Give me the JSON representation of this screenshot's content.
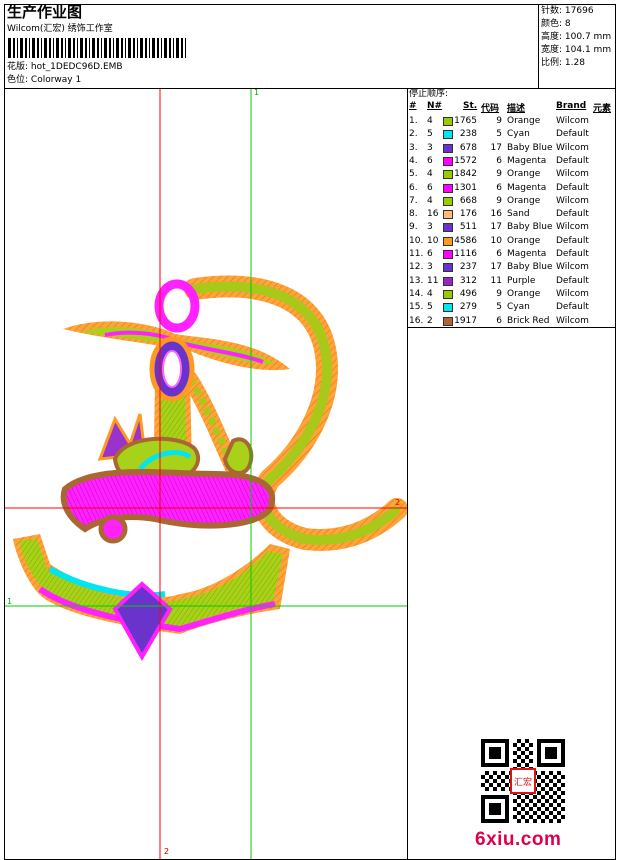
{
  "header": {
    "title": "生产作业图",
    "company": "Wilcom(汇宏) 绣饰工作室",
    "design_label": "花版:",
    "design_value": "hot_1DEDC96D.EMB",
    "colorway_label": "色位:",
    "colorway_value": "Colorway 1"
  },
  "stats": [
    {
      "label": "针数:",
      "value": "17696"
    },
    {
      "label": "颜色:",
      "value": "8"
    },
    {
      "label": "高度:",
      "value": "100.7 mm"
    },
    {
      "label": "宽度:",
      "value": "104.1 mm"
    },
    {
      "label": "比例:",
      "value": "1.28"
    }
  ],
  "sequence": {
    "title": "停止顺序:",
    "headers": {
      "num": "#",
      "needle": "N#",
      "st": "St.",
      "code": "代码",
      "desc": "描述",
      "brand": "Brand",
      "elem": "元素"
    },
    "rows": [
      {
        "num": "1.",
        "needle": "4",
        "color": "#99cc00",
        "st": "1765",
        "code": "9",
        "desc": "Orange",
        "brand": "Wilcom"
      },
      {
        "num": "2.",
        "needle": "5",
        "color": "#00e5ee",
        "st": "238",
        "code": "5",
        "desc": "Cyan",
        "brand": "Default"
      },
      {
        "num": "3.",
        "needle": "3",
        "color": "#6633cc",
        "st": "678",
        "code": "17",
        "desc": "Baby Blue",
        "brand": "Wilcom"
      },
      {
        "num": "4.",
        "needle": "6",
        "color": "#ff00ff",
        "st": "1572",
        "code": "6",
        "desc": "Magenta",
        "brand": "Default"
      },
      {
        "num": "5.",
        "needle": "4",
        "color": "#99cc00",
        "st": "1842",
        "code": "9",
        "desc": "Orange",
        "brand": "Wilcom"
      },
      {
        "num": "6.",
        "needle": "6",
        "color": "#ff00ff",
        "st": "1301",
        "code": "6",
        "desc": "Magenta",
        "brand": "Default"
      },
      {
        "num": "7.",
        "needle": "4",
        "color": "#99cc00",
        "st": "668",
        "code": "9",
        "desc": "Orange",
        "brand": "Wilcom"
      },
      {
        "num": "8.",
        "needle": "16",
        "color": "#ffbb77",
        "st": "176",
        "code": "16",
        "desc": "Sand",
        "brand": "Default"
      },
      {
        "num": "9.",
        "needle": "3",
        "color": "#6633cc",
        "st": "511",
        "code": "17",
        "desc": "Baby Blue",
        "brand": "Wilcom"
      },
      {
        "num": "10.",
        "needle": "10",
        "color": "#ff9922",
        "st": "4586",
        "code": "10",
        "desc": "Orange",
        "brand": "Default"
      },
      {
        "num": "11.",
        "needle": "6",
        "color": "#ff00ff",
        "st": "1116",
        "code": "6",
        "desc": "Magenta",
        "brand": "Default"
      },
      {
        "num": "12.",
        "needle": "3",
        "color": "#6633cc",
        "st": "237",
        "code": "17",
        "desc": "Baby Blue",
        "brand": "Wilcom"
      },
      {
        "num": "13.",
        "needle": "11",
        "color": "#9922cc",
        "st": "312",
        "code": "11",
        "desc": "Purple",
        "brand": "Default"
      },
      {
        "num": "14.",
        "needle": "4",
        "color": "#99cc00",
        "st": "496",
        "code": "9",
        "desc": "Orange",
        "brand": "Wilcom"
      },
      {
        "num": "15.",
        "needle": "5",
        "color": "#00e5ee",
        "st": "279",
        "code": "5",
        "desc": "Cyan",
        "brand": "Default"
      },
      {
        "num": "16.",
        "needle": "2",
        "color": "#aa6633",
        "st": "1917",
        "code": "6",
        "desc": "Brick Red",
        "brand": "Wilcom"
      }
    ]
  },
  "guides": {
    "v1": "1",
    "v2": "2",
    "h1": "1",
    "h2": "2"
  },
  "watermark": "6xiu.com",
  "stamp": "汇宏",
  "colors": {
    "red_guide": "#ff0000",
    "green_guide": "#00cc00",
    "watermark": "#e0004a"
  }
}
